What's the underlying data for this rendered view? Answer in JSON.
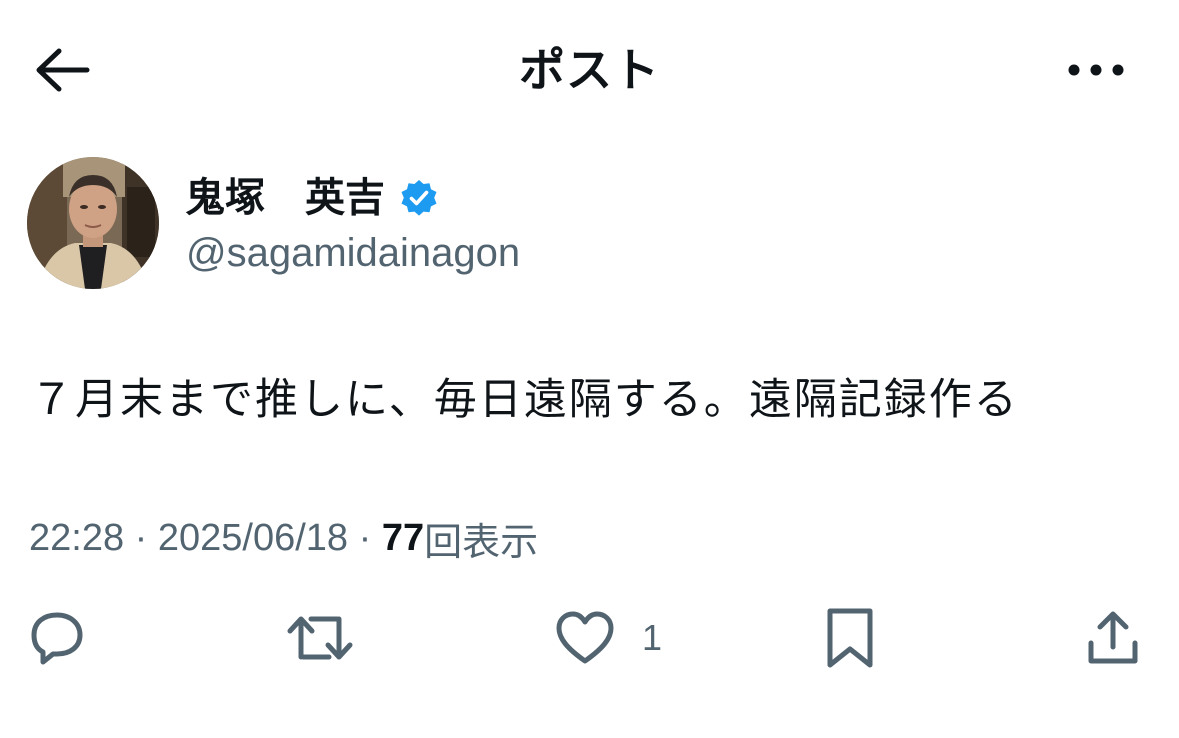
{
  "header": {
    "title": "ポスト",
    "back_icon": "arrow-left-icon",
    "more_icon": "more-horizontal-icon"
  },
  "author": {
    "name": "鬼塚　英吉",
    "handle": "@sagamidainagon",
    "verified_icon": "verified-badge-icon",
    "verified_color": "#1d9bf0"
  },
  "post": {
    "text": "７月末まで推しに、毎日遠隔する。遠隔記録作る"
  },
  "meta": {
    "time": "22:28",
    "separator1": " · ",
    "date": "2025/06/18",
    "separator2": " · ",
    "views_count": "77",
    "views_label": "回表示"
  },
  "actions": {
    "reply_icon": "reply-icon",
    "repost_icon": "repost-icon",
    "like_icon": "heart-icon",
    "like_count": "1",
    "bookmark_icon": "bookmark-icon",
    "share_icon": "share-icon"
  },
  "colors": {
    "text": "#0f1419",
    "secondary": "#536471",
    "accent": "#1d9bf0",
    "background": "#ffffff"
  }
}
